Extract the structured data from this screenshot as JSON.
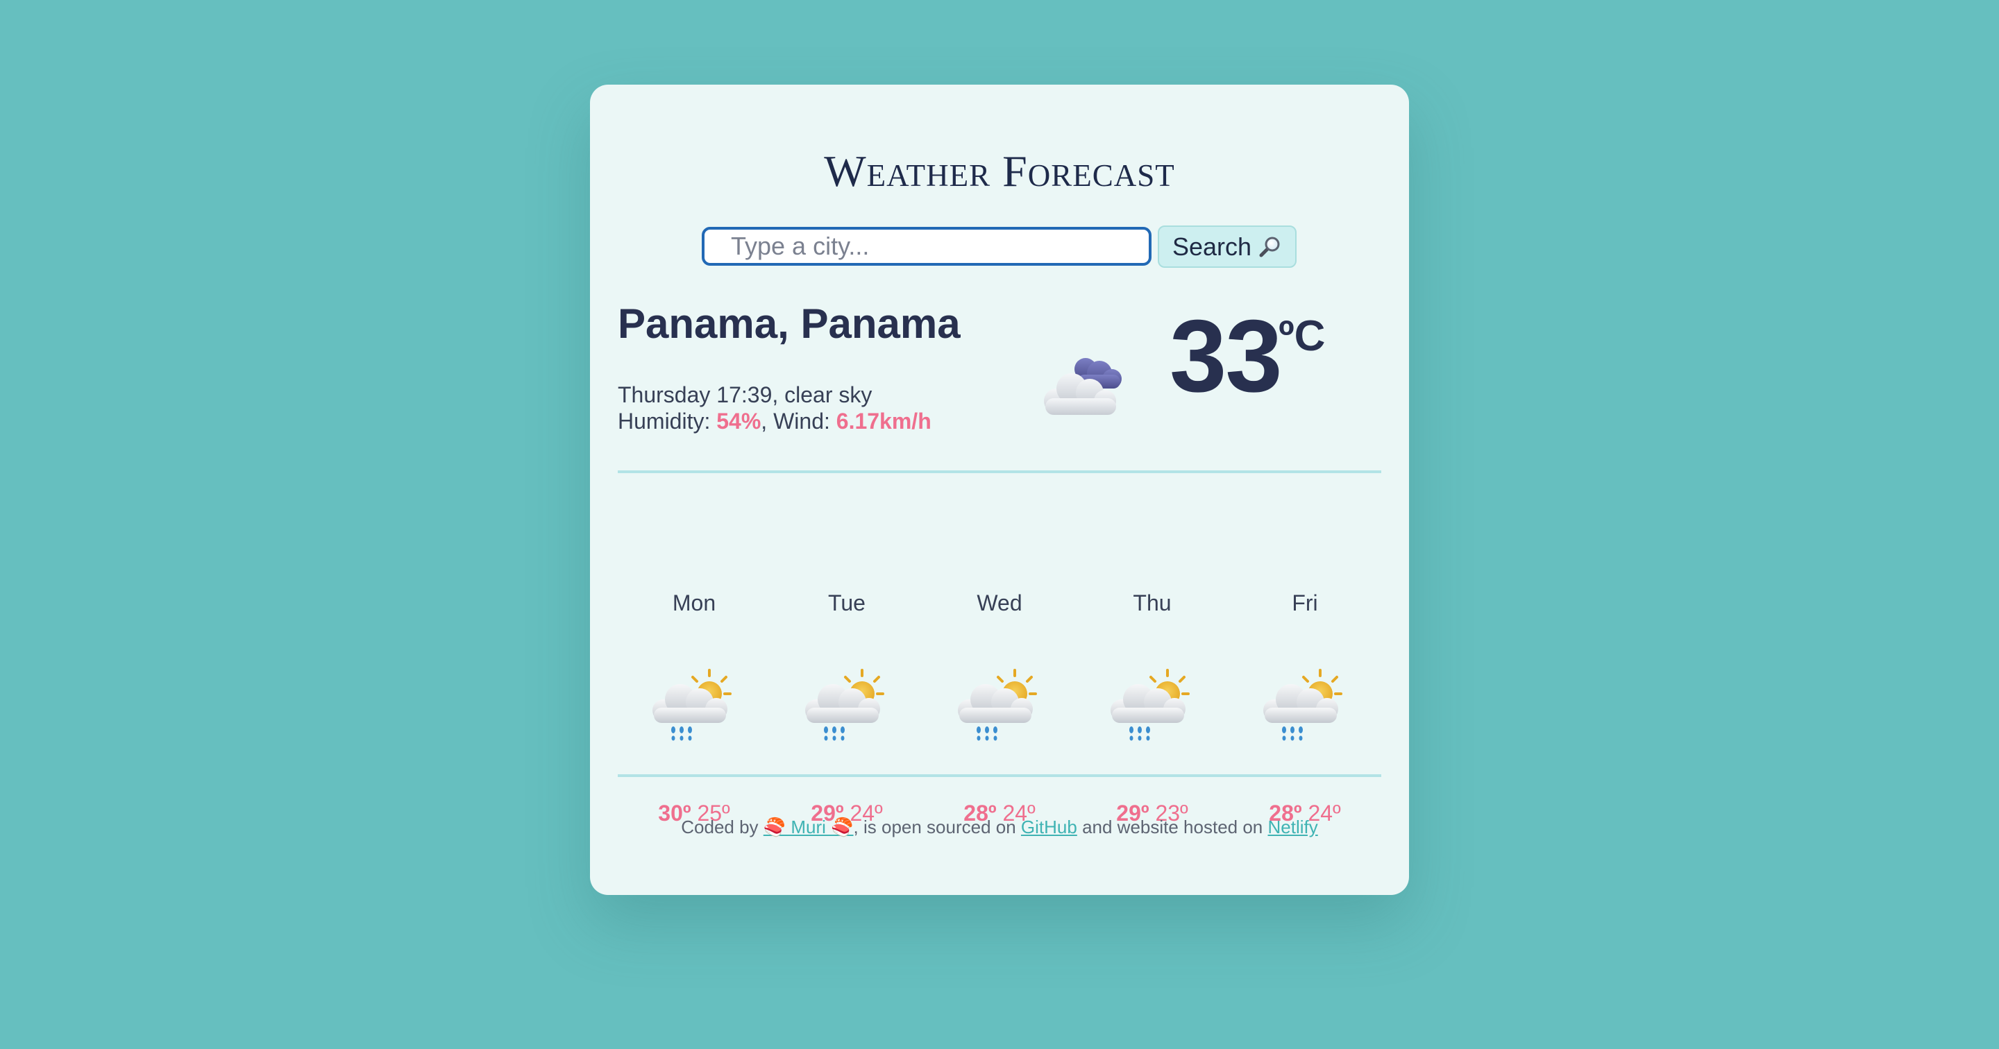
{
  "app": {
    "title": "Weather Forecast"
  },
  "search": {
    "placeholder": "Type a city...",
    "value": "",
    "button_label": "Search"
  },
  "current": {
    "city": "Panama, Panama",
    "datetime_description": "Thursday 17:39, clear sky",
    "humidity_label": "Humidity: ",
    "humidity_value": "54%",
    "wind_label": ", Wind: ",
    "wind_value": "6.17km/h",
    "temperature": "33",
    "unit": "ºC",
    "icon": "night-cloud-icon"
  },
  "forecast": [
    {
      "day": "Mon",
      "max": "30º",
      "min": "25º",
      "icon": "sun-cloud-rain-icon"
    },
    {
      "day": "Tue",
      "max": "29º",
      "min": "24º",
      "icon": "sun-cloud-rain-icon"
    },
    {
      "day": "Wed",
      "max": "28º",
      "min": "24º",
      "icon": "sun-cloud-rain-icon"
    },
    {
      "day": "Thu",
      "max": "29º",
      "min": "23º",
      "icon": "sun-cloud-rain-icon"
    },
    {
      "day": "Fri",
      "max": "28º",
      "min": "24º",
      "icon": "sun-cloud-rain-icon"
    }
  ],
  "footer": {
    "prefix": "Coded by ",
    "author_link": "🍣 Muri 🍣",
    "middle": ", is open sourced on ",
    "github_link": "GitHub",
    "middle2": " and website hosted on ",
    "netlify_link": "Netlify"
  },
  "colors": {
    "background": "#66bfbf",
    "card": "#ebf7f6",
    "accent": "#ef6f8e",
    "link": "#3fb3b3",
    "text_dark": "#28304f"
  }
}
